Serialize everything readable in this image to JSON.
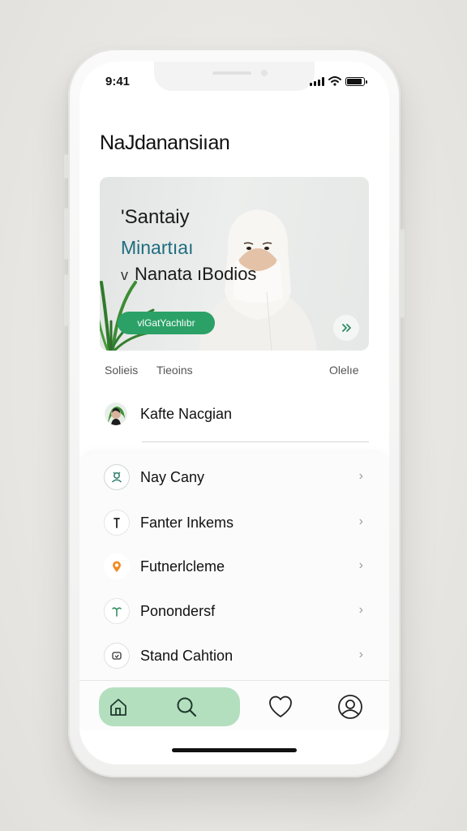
{
  "status_bar": {
    "time": "9:41",
    "battery_level": 0.9,
    "signal_bars": 4
  },
  "app": {
    "title": "NaJdanansiıan"
  },
  "hero": {
    "line1": "'Santaiy",
    "line2": "Minartıaı",
    "line3_prefix": "v",
    "line3": "Nanata ıBodios",
    "cta_label": "vlGatYachlıbr",
    "next_icon": "double-chevron-right-icon",
    "accent_color": "#2ba168",
    "subtitle_color": "#1f6d80"
  },
  "tabs": [
    "Solieis",
    "Tieoins",
    "Olelıe"
  ],
  "profile": {
    "name": "Kafte Nacgian",
    "avatar_icon": "person-avatar-icon"
  },
  "menu": {
    "items": [
      {
        "label": "Nay Cany",
        "icon": "user-badge-icon"
      },
      {
        "label": "Fanter Inkems",
        "icon": "pin-icon"
      },
      {
        "label": "Futnerlcleme",
        "icon": "location-pin-icon"
      },
      {
        "label": "Ponondersf",
        "icon": "sprout-icon"
      },
      {
        "label": "Stand Cahtion",
        "icon": "chat-icon"
      }
    ],
    "chevron_icon": "chevron-right-icon"
  },
  "bottom_nav": {
    "items": [
      "home-icon",
      "search-icon",
      "heart-icon",
      "profile-icon"
    ],
    "active_color": "#b4dfbf"
  }
}
